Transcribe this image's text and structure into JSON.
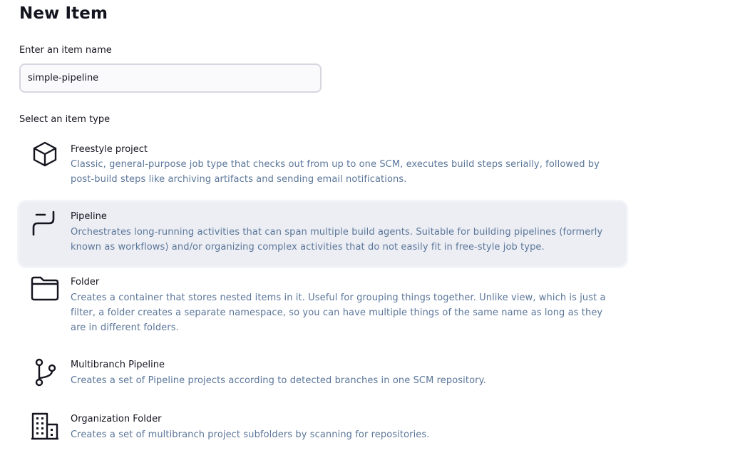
{
  "page": {
    "title": "New Item"
  },
  "name_field": {
    "label": "Enter an item name",
    "value": "simple-pipeline"
  },
  "item_types": {
    "label": "Select an item type",
    "selected": "Pipeline",
    "items": [
      {
        "title": "Freestyle project",
        "description": "Classic, general-purpose job type that checks out from up to one SCM, executes build steps serially, followed by post-build steps like archiving artifacts and sending email notifications.",
        "icon": "cube-icon"
      },
      {
        "title": "Pipeline",
        "description": "Orchestrates long-running activities that can span multiple build agents. Suitable for building pipelines (formerly known as workflows) and/or organizing complex activities that do not easily fit in free-style job type.",
        "icon": "pipeline-icon"
      },
      {
        "title": "Folder",
        "description": "Creates a container that stores nested items in it. Useful for grouping things together. Unlike view, which is just a filter, a folder creates a separate namespace, so you can have multiple things of the same name as long as they are in different folders.",
        "icon": "folder-icon"
      },
      {
        "title": "Multibranch Pipeline",
        "description": "Creates a set of Pipeline projects according to detected branches in one SCM repository.",
        "icon": "branch-icon"
      },
      {
        "title": "Organization Folder",
        "description": "Creates a set of multibranch project subfolders by scanning for repositories.",
        "icon": "building-icon"
      }
    ]
  },
  "colors": {
    "text": "#14141f",
    "description": "#5b7699",
    "selected_background": "#eceef4",
    "input_border": "#d6d6e0"
  }
}
